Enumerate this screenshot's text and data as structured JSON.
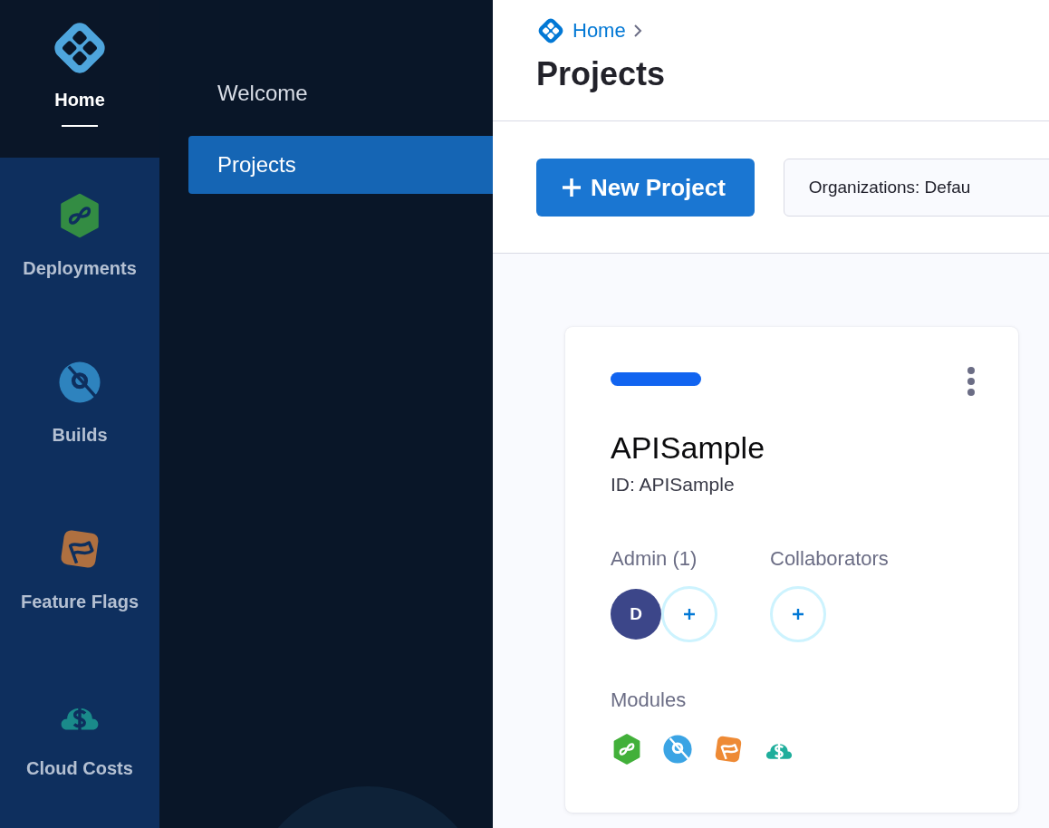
{
  "rail": [
    {
      "label": "Home",
      "kind": "home",
      "selected": true
    },
    {
      "label": "Deployments",
      "kind": "deployments",
      "selected": false
    },
    {
      "label": "Builds",
      "kind": "builds",
      "selected": false
    },
    {
      "label": "Feature Flags",
      "kind": "flags",
      "selected": false
    },
    {
      "label": "Cloud Costs",
      "kind": "costs",
      "selected": false
    }
  ],
  "menu": [
    {
      "label": "Welcome",
      "selected": false
    },
    {
      "label": "Projects",
      "selected": true
    }
  ],
  "breadcrumb": {
    "label": "Home"
  },
  "title": "Projects",
  "toolbar": {
    "new_project": "New Project",
    "organization_filter": "Organizations: Defau"
  },
  "project": {
    "color": "#1164f0",
    "name": "APISample",
    "id": "ID: APISample",
    "admin_label": "Admin (1)",
    "admins": [
      {
        "initial": "D"
      }
    ],
    "collaborators_label": "Collaborators",
    "modules_label": "Modules",
    "modules": [
      {
        "kind": "deployments"
      },
      {
        "kind": "builds"
      },
      {
        "kind": "flags"
      },
      {
        "kind": "costs"
      }
    ]
  }
}
